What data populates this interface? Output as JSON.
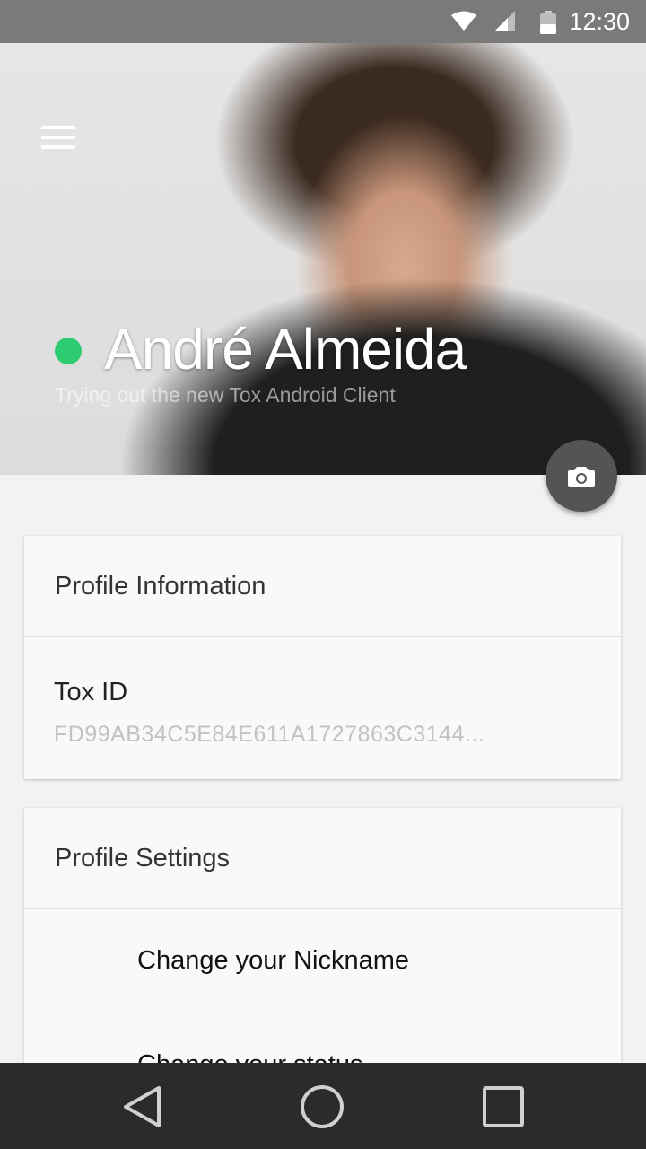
{
  "status_bar": {
    "time": "12:30"
  },
  "header": {
    "name": "André Almeida",
    "status_message": "Trying out the new Tox Android Client",
    "online_color": "#2ecc71"
  },
  "profile_info_card": {
    "title": "Profile Information",
    "tox_id_label": "Tox ID",
    "tox_id_value": "FD99AB34C5E84E611A1727863C3144..."
  },
  "profile_settings_card": {
    "title": "Profile Settings",
    "items": [
      {
        "label": "Change your Nickname"
      },
      {
        "label": "Change your status"
      }
    ]
  },
  "icons": {
    "menu": "menu-icon",
    "camera": "camera-icon",
    "back": "back-icon",
    "home": "home-icon",
    "recents": "recents-icon"
  }
}
